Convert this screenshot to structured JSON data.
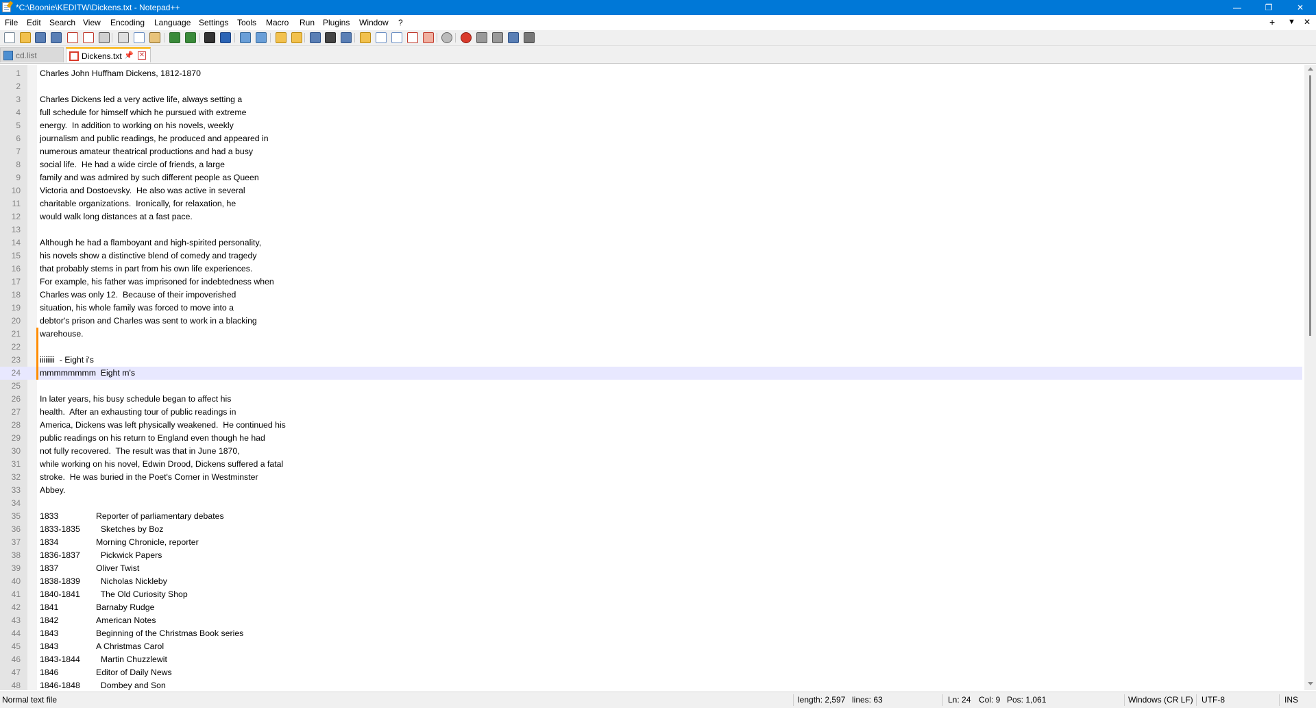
{
  "window": {
    "title": "*C:\\Boonie\\KEDITW\\Dickens.txt - Notepad++",
    "minimize_glyph": "—",
    "maximize_glyph": "❐",
    "close_glyph": "✕"
  },
  "menu": {
    "items": [
      "File",
      "Edit",
      "Search",
      "View",
      "Encoding",
      "Language",
      "Settings",
      "Tools",
      "Macro",
      "Run",
      "Plugins",
      "Window",
      "?"
    ],
    "right_controls": [
      "+",
      "▼",
      "✕"
    ]
  },
  "toolbar": {
    "icons": [
      "new-file-icon",
      "open-file-icon",
      "save-icon",
      "save-all-icon",
      "close-icon",
      "close-all-icon",
      "print-icon",
      "cut-icon",
      "copy-icon",
      "paste-icon",
      "undo-icon",
      "redo-icon",
      "find-icon",
      "replace-icon",
      "zoom-in-icon",
      "zoom-out-icon",
      "sync-vertical-icon",
      "sync-horizontal-icon",
      "word-wrap-icon",
      "show-all-characters-icon",
      "indent-guide-icon",
      "user-language-icon",
      "document-map-icon",
      "function-list-icon",
      "folder-workspace-icon",
      "doc-list-icon",
      "monitoring-icon",
      "record-macro-icon",
      "stop-macro-icon",
      "play-macro-icon",
      "run-macro-multiple-icon",
      "save-macro-icon"
    ]
  },
  "tabs": [
    {
      "label": "cd.list",
      "active": false
    },
    {
      "label": "Dickens.txt",
      "active": true,
      "pin_glyph": "📌",
      "close_glyph": "✕"
    }
  ],
  "editor": {
    "current_line": 24,
    "changed_lines": [
      21,
      22,
      23,
      24
    ],
    "lines": [
      "Charles John Huffham Dickens, 1812-1870",
      "",
      "Charles Dickens led a very active life, always setting a",
      "full schedule for himself which he pursued with extreme",
      "energy.  In addition to working on his novels, weekly",
      "journalism and public readings, he produced and appeared in",
      "numerous amateur theatrical productions and had a busy",
      "social life.  He had a wide circle of friends, a large",
      "family and was admired by such different people as Queen",
      "Victoria and Dostoevsky.  He also was active in several",
      "charitable organizations.  Ironically, for relaxation, he",
      "would walk long distances at a fast pace.",
      "",
      "Although he had a flamboyant and high-spirited personality,",
      "his novels show a distinctive blend of comedy and tragedy",
      "that probably stems in part from his own life experiences.",
      "For example, his father was imprisoned for indebtedness when",
      "Charles was only 12.  Because of their impoverished",
      "situation, his whole family was forced to move into a",
      "debtor's prison and Charles was sent to work in a blacking",
      "warehouse.",
      "",
      "iiiiiiii  - Eight i's",
      "mmmmmmmm  Eight m's",
      "",
      "In later years, his busy schedule began to affect his",
      "health.  After an exhausting tour of public readings in",
      "America, Dickens was left physically weakened.  He continued his",
      "public readings on his return to England even though he had",
      "not fully recovered.  The result was that in June 1870,",
      "while working on his novel, Edwin Drood, Dickens suffered a fatal",
      "stroke.  He was buried in the Poet's Corner in Westminster",
      "Abbey.",
      "",
      "1833\t\tReporter of parliamentary debates",
      "1833-1835\t  Sketches by Boz",
      "1834\t\tMorning Chronicle, reporter",
      "1836-1837\t  Pickwick Papers",
      "1837\t\tOliver Twist",
      "1838-1839\t  Nicholas Nickleby",
      "1840-1841\t  The Old Curiosity Shop",
      "1841\t\tBarnaby Rudge",
      "1842\t\tAmerican Notes",
      "1843\t\tBeginning of the Christmas Book series",
      "1843\t\tA Christmas Carol",
      "1843-1844\t  Martin Chuzzlewit",
      "1846\t\tEditor of Daily News",
      "1846-1848\t  Dombey and Son"
    ]
  },
  "statusbar": {
    "file_type": "Normal text file",
    "length": "length: 2,597",
    "lines": "lines: 63",
    "ln": "Ln: 24",
    "col": "Col: 9",
    "pos": "Pos: 1,061",
    "eol": "Windows (CR LF)",
    "encoding": "UTF-8",
    "mode": "INS"
  },
  "colors": {
    "titlebar": "#0078d7",
    "current_line": "#e8e8ff",
    "change_mark": "#ff8c00",
    "gutter": "#e4e4e4",
    "active_tab_accent": "#fab000"
  }
}
